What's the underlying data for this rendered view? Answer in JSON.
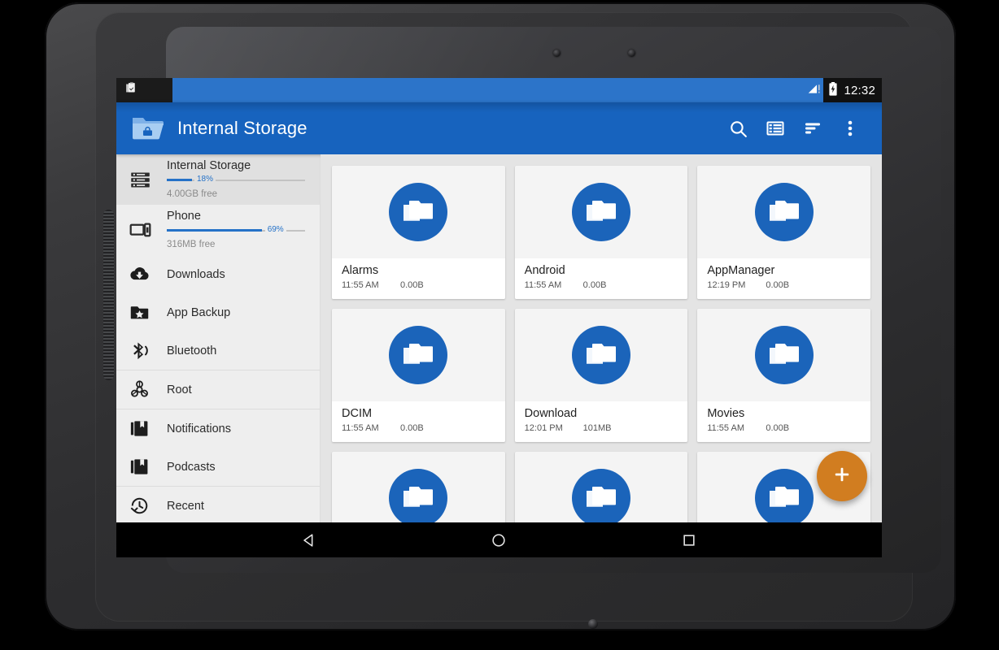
{
  "device": {
    "name": "android-tablet-mockup"
  },
  "status_bar": {
    "left_icon": "clipboard-check-icon",
    "signal_icon": "signal-warning-icon",
    "battery_icon": "battery-charging-icon",
    "time": "12:32"
  },
  "app_bar": {
    "logo_icon": "folder-lock-icon",
    "title": "Internal Storage",
    "actions": [
      {
        "name": "search-icon",
        "label": "Search"
      },
      {
        "name": "view-list-icon",
        "label": "View mode"
      },
      {
        "name": "sort-icon",
        "label": "Sort"
      },
      {
        "name": "overflow-menu-icon",
        "label": "More options"
      }
    ]
  },
  "sidebar": {
    "storage": [
      {
        "name": "Internal Storage",
        "percent_label": "18%",
        "percent": 18,
        "free": "4.00GB free",
        "icon": "storage-icon",
        "selected": true
      },
      {
        "name": "Phone",
        "percent_label": "69%",
        "percent": 69,
        "free": "316MB free",
        "icon": "phone-tablet-icon",
        "selected": false
      }
    ],
    "items": [
      {
        "label": "Downloads",
        "icon": "cloud-download-icon",
        "divider_before": false
      },
      {
        "label": "App Backup",
        "icon": "folder-star-icon",
        "divider_before": false
      },
      {
        "label": "Bluetooth",
        "icon": "bluetooth-icon",
        "divider_before": false
      },
      {
        "label": "Root",
        "icon": "biohazard-icon",
        "divider_before": true
      },
      {
        "label": "Notifications",
        "icon": "library-books-icon",
        "divider_before": true
      },
      {
        "label": "Podcasts",
        "icon": "library-books-icon",
        "divider_before": false
      },
      {
        "label": "Recent",
        "icon": "history-icon",
        "divider_before": true
      }
    ]
  },
  "files": {
    "items": [
      {
        "name": "Alarms",
        "time": "11:55 AM",
        "size": "0.00B",
        "icon": "folder-copy-icon"
      },
      {
        "name": "Android",
        "time": "11:55 AM",
        "size": "0.00B",
        "icon": "folder-copy-icon"
      },
      {
        "name": "AppManager",
        "time": "12:19 PM",
        "size": "0.00B",
        "icon": "folder-copy-icon"
      },
      {
        "name": "DCIM",
        "time": "11:55 AM",
        "size": "0.00B",
        "icon": "folder-copy-icon"
      },
      {
        "name": "Download",
        "time": "12:01 PM",
        "size": "101MB",
        "icon": "folder-copy-icon"
      },
      {
        "name": "Movies",
        "time": "11:55 AM",
        "size": "0.00B",
        "icon": "folder-copy-icon"
      },
      {
        "name": "",
        "time": "",
        "size": "",
        "icon": "folder-copy-icon"
      },
      {
        "name": "",
        "time": "",
        "size": "",
        "icon": "folder-copy-icon"
      },
      {
        "name": "",
        "time": "",
        "size": "",
        "icon": "folder-copy-icon"
      }
    ]
  },
  "fab": {
    "icon": "plus-icon",
    "label": "+"
  },
  "nav_bar": {
    "back": "back-triangle-icon",
    "home": "home-circle-icon",
    "recents": "recents-square-icon"
  },
  "colors": {
    "app_bar": "#1763be",
    "accent_blue": "#2572c8",
    "folder_blue": "#1b64ba",
    "fab_orange": "#d17d20",
    "sidebar_bg": "#eeeeee",
    "content_bg": "#e4e4e4",
    "card_bg": "#f4f4f4"
  }
}
